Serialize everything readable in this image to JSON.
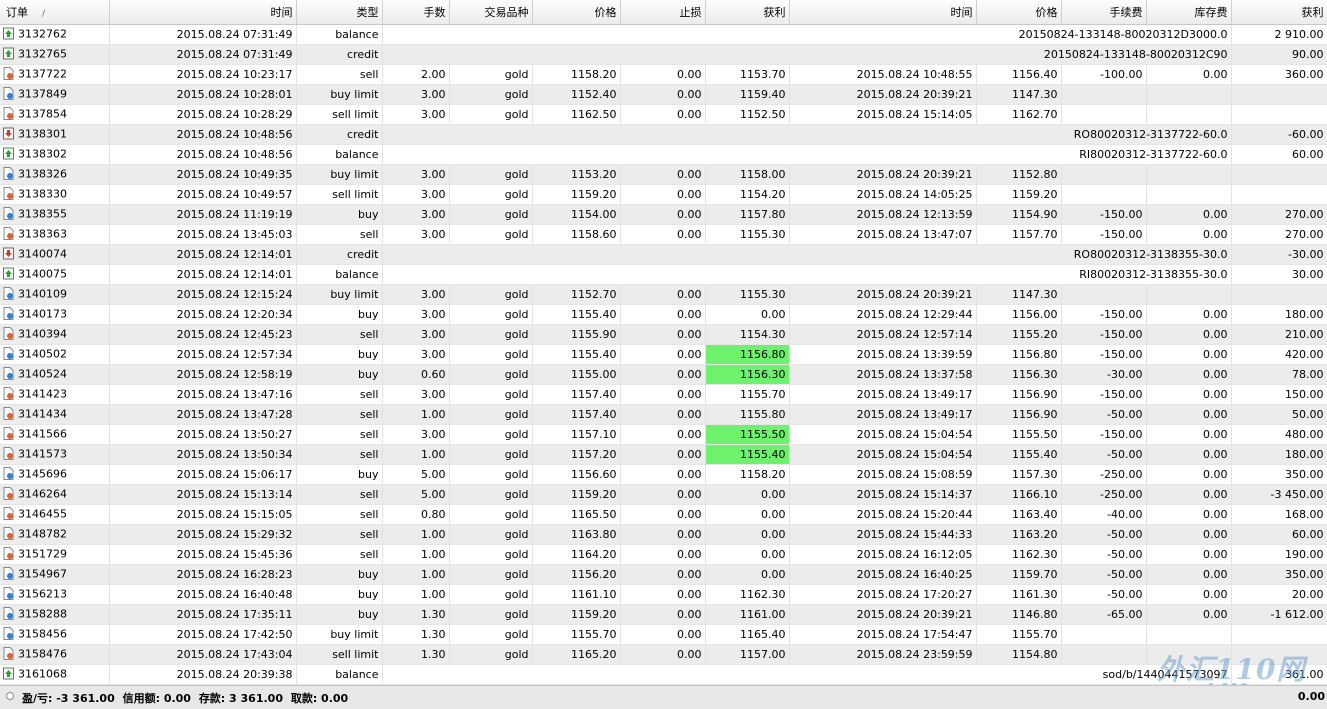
{
  "columns": [
    "订单",
    "时间",
    "类型",
    "手数",
    "交易品种",
    "价格",
    "止损",
    "获利",
    "时间",
    "价格",
    "手续费",
    "库存费",
    "获利"
  ],
  "sort_indicator": "/",
  "rows": [
    {
      "order": "3132762",
      "icon": "deposit",
      "time": "2015.08.24 07:31:49",
      "type": "balance",
      "comment": "20150824-133148-80020312D3000.0",
      "profit": "2 910.00"
    },
    {
      "order": "3132765",
      "icon": "deposit",
      "time": "2015.08.24 07:31:49",
      "type": "credit",
      "comment": "20150824-133148-80020312C90",
      "profit": "90.00"
    },
    {
      "order": "3137722",
      "icon": "sell",
      "time": "2015.08.24 10:23:17",
      "type": "sell",
      "lots": "2.00",
      "symbol": "gold",
      "price": "1158.20",
      "sl": "0.00",
      "tp": "1153.70",
      "close_time": "2015.08.24 10:48:55",
      "close_price": "1156.40",
      "commission": "-100.00",
      "swap": "0.00",
      "profit": "360.00"
    },
    {
      "order": "3137849",
      "icon": "buy",
      "time": "2015.08.24 10:28:01",
      "type": "buy limit",
      "lots": "3.00",
      "symbol": "gold",
      "price": "1152.40",
      "sl": "0.00",
      "tp": "1159.40",
      "close_time": "2015.08.24 20:39:21",
      "close_price": "1147.30"
    },
    {
      "order": "3137854",
      "icon": "sell",
      "time": "2015.08.24 10:28:29",
      "type": "sell limit",
      "lots": "3.00",
      "symbol": "gold",
      "price": "1162.50",
      "sl": "0.00",
      "tp": "1152.50",
      "close_time": "2015.08.24 15:14:05",
      "close_price": "1162.70"
    },
    {
      "order": "3138301",
      "icon": "withdraw",
      "time": "2015.08.24 10:48:56",
      "type": "credit",
      "comment": "RO80020312-3137722-60.0",
      "profit": "-60.00"
    },
    {
      "order": "3138302",
      "icon": "deposit",
      "time": "2015.08.24 10:48:56",
      "type": "balance",
      "comment": "RI80020312-3137722-60.0",
      "profit": "60.00"
    },
    {
      "order": "3138326",
      "icon": "buy",
      "time": "2015.08.24 10:49:35",
      "type": "buy limit",
      "lots": "3.00",
      "symbol": "gold",
      "price": "1153.20",
      "sl": "0.00",
      "tp": "1158.00",
      "close_time": "2015.08.24 20:39:21",
      "close_price": "1152.80"
    },
    {
      "order": "3138330",
      "icon": "sell",
      "time": "2015.08.24 10:49:57",
      "type": "sell limit",
      "lots": "3.00",
      "symbol": "gold",
      "price": "1159.20",
      "sl": "0.00",
      "tp": "1154.20",
      "close_time": "2015.08.24 14:05:25",
      "close_price": "1159.20"
    },
    {
      "order": "3138355",
      "icon": "buy",
      "time": "2015.08.24 11:19:19",
      "type": "buy",
      "lots": "3.00",
      "symbol": "gold",
      "price": "1154.00",
      "sl": "0.00",
      "tp": "1157.80",
      "close_time": "2015.08.24 12:13:59",
      "close_price": "1154.90",
      "commission": "-150.00",
      "swap": "0.00",
      "profit": "270.00"
    },
    {
      "order": "3138363",
      "icon": "sell",
      "time": "2015.08.24 13:45:03",
      "type": "sell",
      "lots": "3.00",
      "symbol": "gold",
      "price": "1158.60",
      "sl": "0.00",
      "tp": "1155.30",
      "close_time": "2015.08.24 13:47:07",
      "close_price": "1157.70",
      "commission": "-150.00",
      "swap": "0.00",
      "profit": "270.00"
    },
    {
      "order": "3140074",
      "icon": "withdraw",
      "time": "2015.08.24 12:14:01",
      "type": "credit",
      "comment": "RO80020312-3138355-30.0",
      "profit": "-30.00"
    },
    {
      "order": "3140075",
      "icon": "deposit",
      "time": "2015.08.24 12:14:01",
      "type": "balance",
      "comment": "RI80020312-3138355-30.0",
      "profit": "30.00"
    },
    {
      "order": "3140109",
      "icon": "buy",
      "time": "2015.08.24 12:15:24",
      "type": "buy limit",
      "lots": "3.00",
      "symbol": "gold",
      "price": "1152.70",
      "sl": "0.00",
      "tp": "1155.30",
      "close_time": "2015.08.24 20:39:21",
      "close_price": "1147.30"
    },
    {
      "order": "3140173",
      "icon": "buy",
      "time": "2015.08.24 12:20:34",
      "type": "buy",
      "lots": "3.00",
      "symbol": "gold",
      "price": "1155.40",
      "sl": "0.00",
      "tp": "0.00",
      "close_time": "2015.08.24 12:29:44",
      "close_price": "1156.00",
      "commission": "-150.00",
      "swap": "0.00",
      "profit": "180.00"
    },
    {
      "order": "3140394",
      "icon": "sell",
      "time": "2015.08.24 12:45:23",
      "type": "sell",
      "lots": "3.00",
      "symbol": "gold",
      "price": "1155.90",
      "sl": "0.00",
      "tp": "1154.30",
      "close_time": "2015.08.24 12:57:14",
      "close_price": "1155.20",
      "commission": "-150.00",
      "swap": "0.00",
      "profit": "210.00"
    },
    {
      "order": "3140502",
      "icon": "buy",
      "time": "2015.08.24 12:57:34",
      "type": "buy",
      "lots": "3.00",
      "symbol": "gold",
      "price": "1155.40",
      "sl": "0.00",
      "tp": "1156.80",
      "tp_hit": true,
      "close_time": "2015.08.24 13:39:59",
      "close_price": "1156.80",
      "commission": "-150.00",
      "swap": "0.00",
      "profit": "420.00"
    },
    {
      "order": "3140524",
      "icon": "buy",
      "time": "2015.08.24 12:58:19",
      "type": "buy",
      "lots": "0.60",
      "symbol": "gold",
      "price": "1155.00",
      "sl": "0.00",
      "tp": "1156.30",
      "tp_hit": true,
      "close_time": "2015.08.24 13:37:58",
      "close_price": "1156.30",
      "commission": "-30.00",
      "swap": "0.00",
      "profit": "78.00"
    },
    {
      "order": "3141423",
      "icon": "sell",
      "time": "2015.08.24 13:47:16",
      "type": "sell",
      "lots": "3.00",
      "symbol": "gold",
      "price": "1157.40",
      "sl": "0.00",
      "tp": "1155.70",
      "close_time": "2015.08.24 13:49:17",
      "close_price": "1156.90",
      "commission": "-150.00",
      "swap": "0.00",
      "profit": "150.00"
    },
    {
      "order": "3141434",
      "icon": "sell",
      "time": "2015.08.24 13:47:28",
      "type": "sell",
      "lots": "1.00",
      "symbol": "gold",
      "price": "1157.40",
      "sl": "0.00",
      "tp": "1155.80",
      "close_time": "2015.08.24 13:49:17",
      "close_price": "1156.90",
      "commission": "-50.00",
      "swap": "0.00",
      "profit": "50.00"
    },
    {
      "order": "3141566",
      "icon": "sell",
      "time": "2015.08.24 13:50:27",
      "type": "sell",
      "lots": "3.00",
      "symbol": "gold",
      "price": "1157.10",
      "sl": "0.00",
      "tp": "1155.50",
      "tp_hit": true,
      "close_time": "2015.08.24 15:04:54",
      "close_price": "1155.50",
      "commission": "-150.00",
      "swap": "0.00",
      "profit": "480.00"
    },
    {
      "order": "3141573",
      "icon": "sell",
      "time": "2015.08.24 13:50:34",
      "type": "sell",
      "lots": "1.00",
      "symbol": "gold",
      "price": "1157.20",
      "sl": "0.00",
      "tp": "1155.40",
      "tp_hit": true,
      "close_time": "2015.08.24 15:04:54",
      "close_price": "1155.40",
      "commission": "-50.00",
      "swap": "0.00",
      "profit": "180.00"
    },
    {
      "order": "3145696",
      "icon": "buy",
      "time": "2015.08.24 15:06:17",
      "type": "buy",
      "lots": "5.00",
      "symbol": "gold",
      "price": "1156.60",
      "sl": "0.00",
      "tp": "1158.20",
      "close_time": "2015.08.24 15:08:59",
      "close_price": "1157.30",
      "commission": "-250.00",
      "swap": "0.00",
      "profit": "350.00"
    },
    {
      "order": "3146264",
      "icon": "sell",
      "time": "2015.08.24 15:13:14",
      "type": "sell",
      "lots": "5.00",
      "symbol": "gold",
      "price": "1159.20",
      "sl": "0.00",
      "tp": "0.00",
      "close_time": "2015.08.24 15:14:37",
      "close_price": "1166.10",
      "commission": "-250.00",
      "swap": "0.00",
      "profit": "-3 450.00"
    },
    {
      "order": "3146455",
      "icon": "sell",
      "time": "2015.08.24 15:15:05",
      "type": "sell",
      "lots": "0.80",
      "symbol": "gold",
      "price": "1165.50",
      "sl": "0.00",
      "tp": "0.00",
      "close_time": "2015.08.24 15:20:44",
      "close_price": "1163.40",
      "commission": "-40.00",
      "swap": "0.00",
      "profit": "168.00"
    },
    {
      "order": "3148782",
      "icon": "sell",
      "time": "2015.08.24 15:29:32",
      "type": "sell",
      "lots": "1.00",
      "symbol": "gold",
      "price": "1163.80",
      "sl": "0.00",
      "tp": "0.00",
      "close_time": "2015.08.24 15:44:33",
      "close_price": "1163.20",
      "commission": "-50.00",
      "swap": "0.00",
      "profit": "60.00"
    },
    {
      "order": "3151729",
      "icon": "sell",
      "time": "2015.08.24 15:45:36",
      "type": "sell",
      "lots": "1.00",
      "symbol": "gold",
      "price": "1164.20",
      "sl": "0.00",
      "tp": "0.00",
      "close_time": "2015.08.24 16:12:05",
      "close_price": "1162.30",
      "commission": "-50.00",
      "swap": "0.00",
      "profit": "190.00"
    },
    {
      "order": "3154967",
      "icon": "buy",
      "time": "2015.08.24 16:28:23",
      "type": "buy",
      "lots": "1.00",
      "symbol": "gold",
      "price": "1156.20",
      "sl": "0.00",
      "tp": "0.00",
      "close_time": "2015.08.24 16:40:25",
      "close_price": "1159.70",
      "commission": "-50.00",
      "swap": "0.00",
      "profit": "350.00"
    },
    {
      "order": "3156213",
      "icon": "buy",
      "time": "2015.08.24 16:40:48",
      "type": "buy",
      "lots": "1.00",
      "symbol": "gold",
      "price": "1161.10",
      "sl": "0.00",
      "tp": "1162.30",
      "close_time": "2015.08.24 17:20:27",
      "close_price": "1161.30",
      "commission": "-50.00",
      "swap": "0.00",
      "profit": "20.00"
    },
    {
      "order": "3158288",
      "icon": "buy",
      "time": "2015.08.24 17:35:11",
      "type": "buy",
      "lots": "1.30",
      "symbol": "gold",
      "price": "1159.20",
      "sl": "0.00",
      "tp": "1161.00",
      "close_time": "2015.08.24 20:39:21",
      "close_price": "1146.80",
      "commission": "-65.00",
      "swap": "0.00",
      "profit": "-1 612.00"
    },
    {
      "order": "3158456",
      "icon": "buy",
      "time": "2015.08.24 17:42:50",
      "type": "buy limit",
      "lots": "1.30",
      "symbol": "gold",
      "price": "1155.70",
      "sl": "0.00",
      "tp": "1165.40",
      "close_time": "2015.08.24 17:54:47",
      "close_price": "1155.70"
    },
    {
      "order": "3158476",
      "icon": "sell",
      "time": "2015.08.24 17:43:04",
      "type": "sell limit",
      "lots": "1.30",
      "symbol": "gold",
      "price": "1165.20",
      "sl": "0.00",
      "tp": "1157.00",
      "close_time": "2015.08.24 23:59:59",
      "close_price": "1154.80"
    },
    {
      "order": "3161068",
      "icon": "deposit",
      "time": "2015.08.24 20:39:38",
      "type": "balance",
      "comment": "sod/b/1440441573097",
      "profit": "361.00"
    }
  ],
  "footer": {
    "summary_parts": [
      "盈/亏: -3 361.00",
      "信用额: 0.00",
      "存款: 3 361.00",
      "取款: 0.00"
    ],
    "total": "0.00"
  },
  "watermark": {
    "main": "外汇110网",
    "url": "www.fx110.com"
  },
  "colors": {
    "tp_hit": "#6ef26e",
    "buy_icon": "#2f7fd6",
    "sell_icon": "#e0602a",
    "deposit_icon": "#2aa52a",
    "withdraw_icon": "#d83a2a"
  }
}
